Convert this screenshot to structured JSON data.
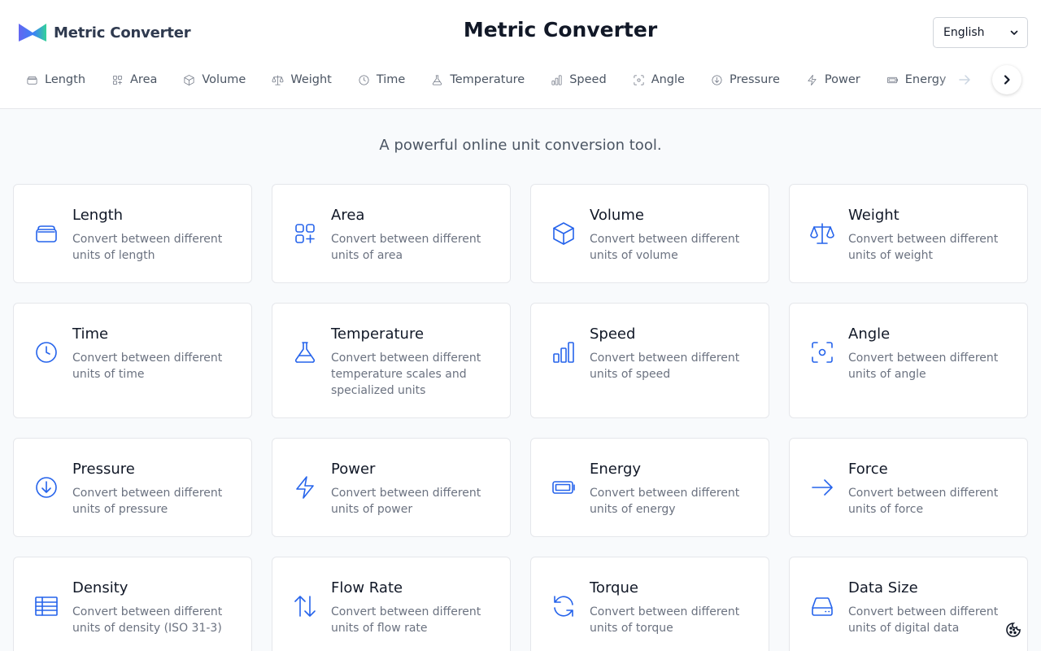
{
  "header": {
    "brand": "Metric Converter",
    "title": "Metric Converter",
    "language": "English"
  },
  "tabs": [
    {
      "label": "Length",
      "icon": "ruler-icon"
    },
    {
      "label": "Area",
      "icon": "shapes-icon"
    },
    {
      "label": "Volume",
      "icon": "box-icon"
    },
    {
      "label": "Weight",
      "icon": "scale-icon"
    },
    {
      "label": "Time",
      "icon": "clock-icon"
    },
    {
      "label": "Temperature",
      "icon": "flask-icon"
    },
    {
      "label": "Speed",
      "icon": "bar-chart-icon"
    },
    {
      "label": "Angle",
      "icon": "focus-icon"
    },
    {
      "label": "Pressure",
      "icon": "arrow-down-circle-icon"
    },
    {
      "label": "Power",
      "icon": "zap-icon"
    },
    {
      "label": "Energy",
      "icon": "battery-icon"
    }
  ],
  "tagline": "A powerful online unit conversion tool.",
  "cards": [
    {
      "title": "Length",
      "desc": "Convert between different units of length",
      "icon": "ruler-icon"
    },
    {
      "title": "Area",
      "desc": "Convert between different units of area",
      "icon": "shapes-icon"
    },
    {
      "title": "Volume",
      "desc": "Convert between different units of volume",
      "icon": "box-icon"
    },
    {
      "title": "Weight",
      "desc": "Convert between different units of weight",
      "icon": "scale-icon"
    },
    {
      "title": "Time",
      "desc": "Convert between different units of time",
      "icon": "clock-icon"
    },
    {
      "title": "Temperature",
      "desc": "Convert between different temperature scales and specialized units",
      "icon": "flask-icon"
    },
    {
      "title": "Speed",
      "desc": "Convert between different units of speed",
      "icon": "bar-chart-icon"
    },
    {
      "title": "Angle",
      "desc": "Convert between different units of angle",
      "icon": "focus-icon"
    },
    {
      "title": "Pressure",
      "desc": "Convert between different units of pressure",
      "icon": "arrow-down-circle-icon"
    },
    {
      "title": "Power",
      "desc": "Convert between different units of power",
      "icon": "zap-icon"
    },
    {
      "title": "Energy",
      "desc": "Convert between different units of energy",
      "icon": "battery-icon"
    },
    {
      "title": "Force",
      "desc": "Convert between different units of force",
      "icon": "arrow-right-icon"
    },
    {
      "title": "Density",
      "desc": "Convert between different units of density (ISO 31-3)",
      "icon": "table-icon"
    },
    {
      "title": "Flow Rate",
      "desc": "Convert between different units of flow rate",
      "icon": "arrow-up-down-icon"
    },
    {
      "title": "Torque",
      "desc": "Convert between different units of torque",
      "icon": "refresh-icon"
    },
    {
      "title": "Data Size",
      "desc": "Convert between different units of digital data",
      "icon": "hard-drive-icon"
    }
  ],
  "colors": {
    "accent": "#2563eb",
    "background": "#f8fafc",
    "card_border": "#e5e7eb"
  }
}
